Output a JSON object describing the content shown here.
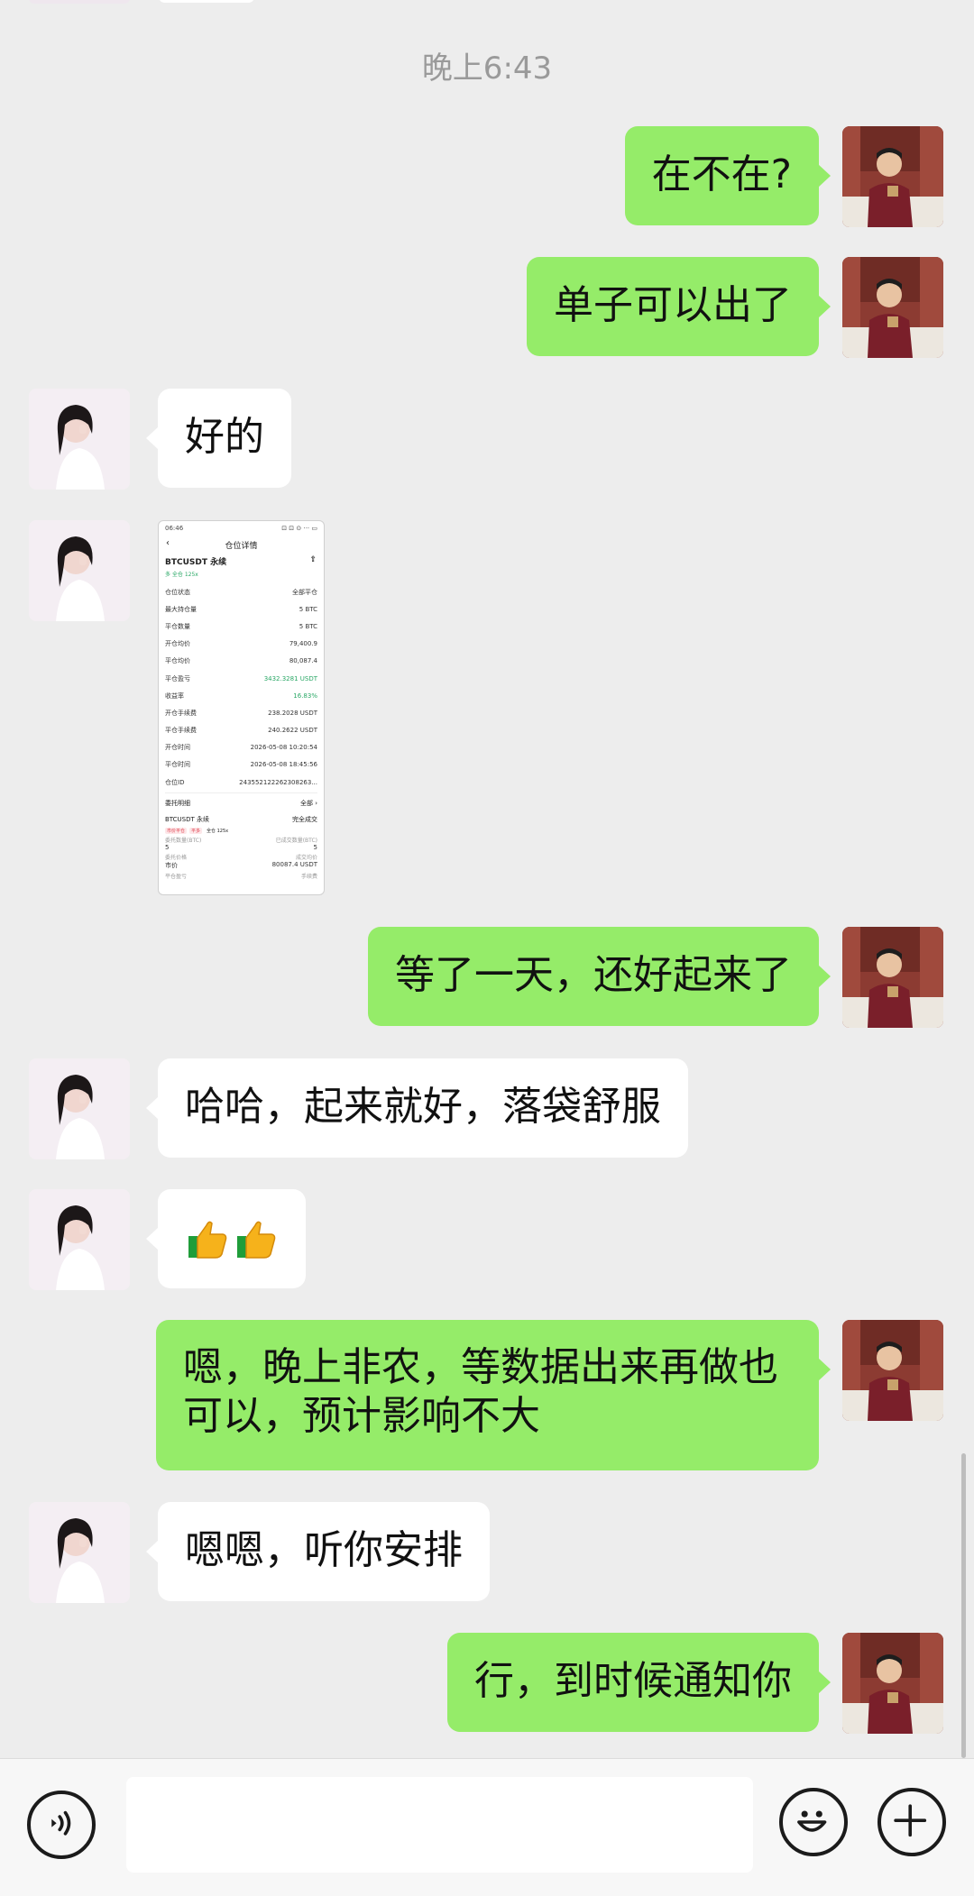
{
  "chat": {
    "timestamp": "晚上6:43",
    "messages": [
      {
        "from": "me",
        "text": "在不在?"
      },
      {
        "from": "me",
        "text": "单子可以出了"
      },
      {
        "from": "them",
        "text": "好的"
      },
      {
        "from": "them",
        "type": "image"
      },
      {
        "from": "me",
        "text": "等了一天，还好起来了"
      },
      {
        "from": "them",
        "text": "哈哈，起来就好，落袋舒服"
      },
      {
        "from": "them",
        "type": "emoji",
        "emoji": [
          "thumbs-up",
          "thumbs-up"
        ]
      },
      {
        "from": "me",
        "text_lines": [
          "嗯，晚上非农，等数据出来再做也",
          "可以，预计影响不大"
        ]
      },
      {
        "from": "them",
        "text": "嗯嗯，听你安排"
      },
      {
        "from": "me",
        "text": "行，到时候通知你"
      }
    ]
  },
  "screenshot": {
    "status_time": "06:46",
    "status_icons": "⊡ ⊡ ⊙ ··· ▭",
    "title": "仓位详情",
    "pair": "BTCUSDT 永续",
    "tags": "多  全仓 125x",
    "rows": [
      {
        "k": "仓位状态",
        "v": "全部平仓"
      },
      {
        "k": "最大持仓量",
        "v": "5 BTC"
      },
      {
        "k": "平仓数量",
        "v": "5 BTC"
      },
      {
        "k": "开仓均价",
        "v": "79,400.9"
      },
      {
        "k": "平仓均价",
        "v": "80,087.4"
      },
      {
        "k": "平仓盈亏",
        "v": "3432.3281 USDT"
      },
      {
        "k": "收益率",
        "v": "16.83%"
      },
      {
        "k": "开仓手续费",
        "v": "238.2028 USDT"
      },
      {
        "k": "平仓手续费",
        "v": "240.2622 USDT"
      },
      {
        "k": "开仓时间",
        "v": "2026-05-08 10:20:54"
      },
      {
        "k": "平仓时间",
        "v": "2026-05-08 18:45:56"
      },
      {
        "k": "仓位ID",
        "v": "243552122262308263..."
      }
    ],
    "section_title": "委托明细",
    "section_right": "全部 ›",
    "order_pair": "BTCUSDT 永续",
    "order_right": "完全成交",
    "badges": [
      "市价平仓",
      "平多",
      "全仓 125x"
    ],
    "small_left_1": "委托数量(BTC)",
    "small_right_1": "已成交数量(BTC)",
    "val_left_1": "5",
    "val_right_1": "5",
    "small_left_2": "委托价格",
    "small_right_2": "成交均价",
    "val_left_2": "市价",
    "val_right_2": "80087.4 USDT",
    "small_left_3": "平仓盈亏",
    "small_right_3": "手续费"
  },
  "input": {
    "placeholder": ""
  }
}
